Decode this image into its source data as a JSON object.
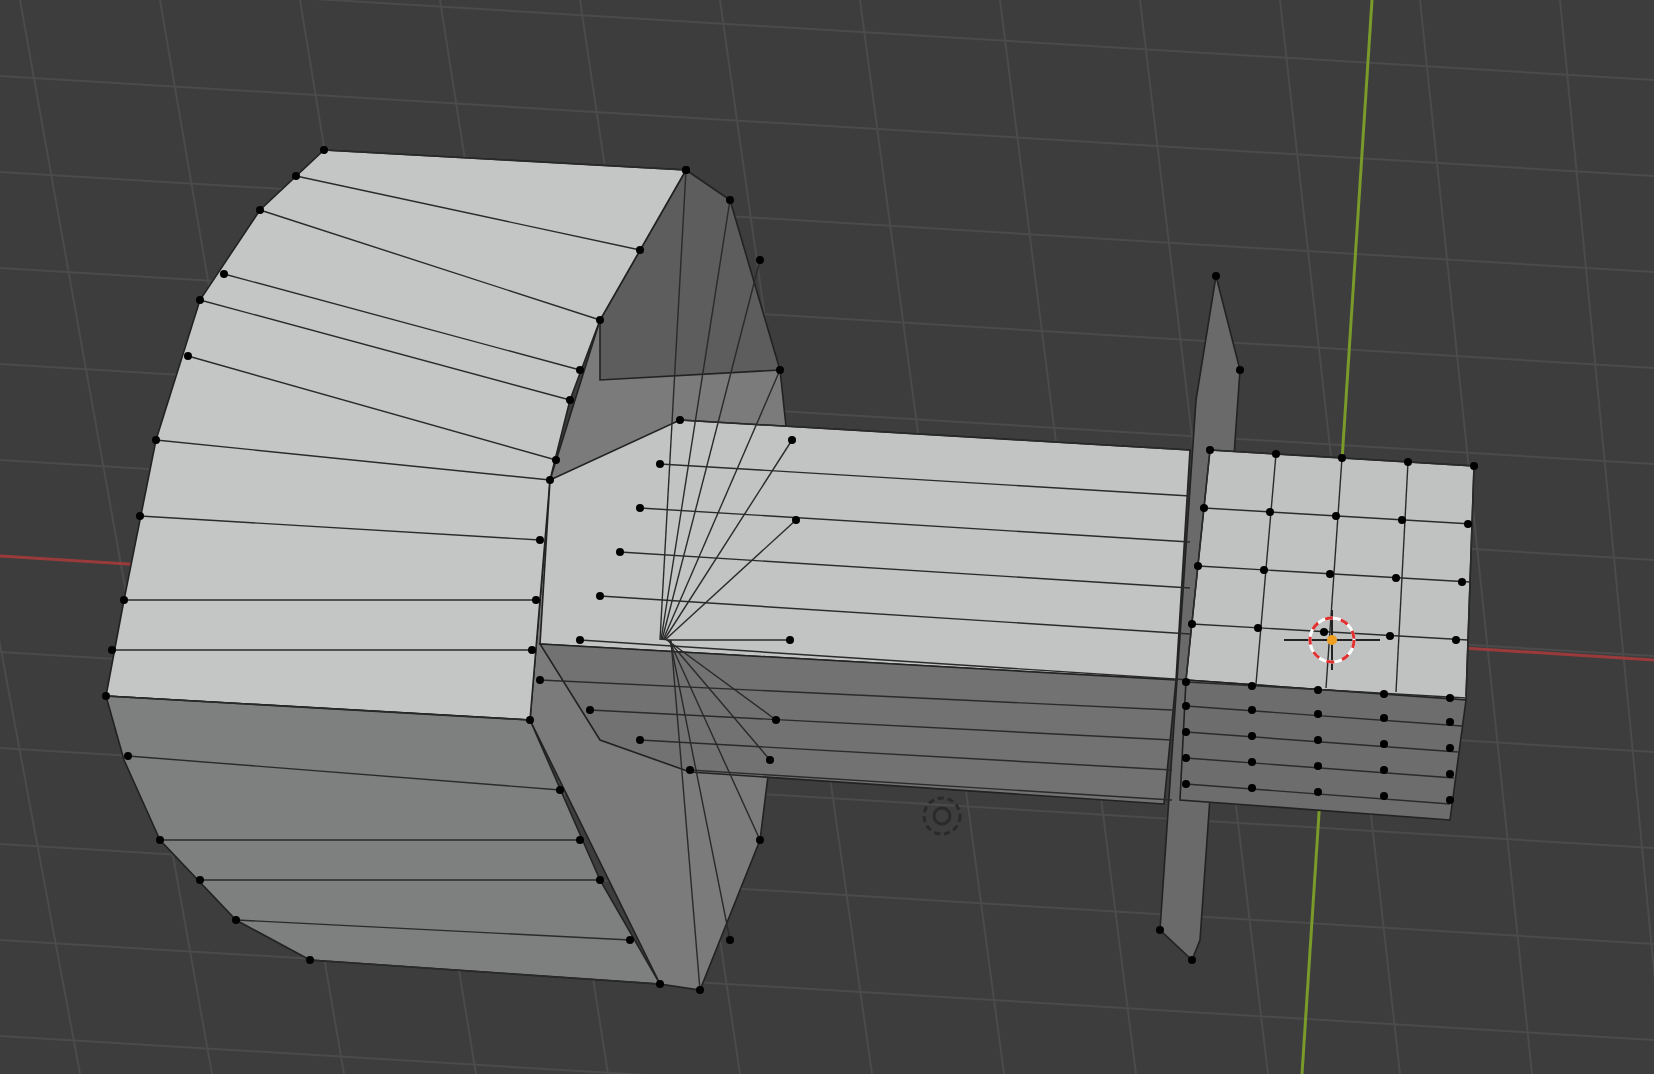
{
  "viewport": {
    "edit_mode": true
  }
}
